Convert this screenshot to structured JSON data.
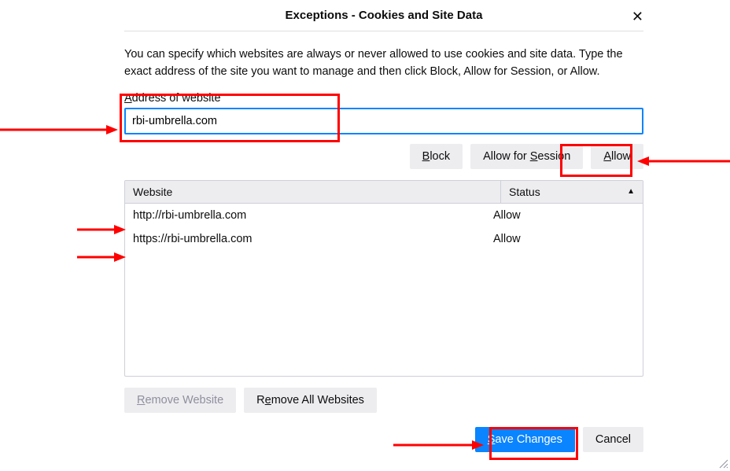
{
  "title": "Exceptions - Cookies and Site Data",
  "description": "You can specify which websites are always or never allowed to use cookies and site data. Type the exact address of the site you want to manage and then click Block, Allow for Session, or Allow.",
  "addressLabelPre": "A",
  "addressLabelRest": "ddress of website",
  "addressValue": "rbi-umbrella.com",
  "buttons": {
    "block_pre": "B",
    "block_rest": "lock",
    "afs_pre": "Allow for ",
    "afs_ul": "S",
    "afs_rest": "ession",
    "allow_ul": "A",
    "allow_rest": "llow",
    "removeWebsite_ul": "R",
    "removeWebsite_rest": "emove Website",
    "removeAll_pre": "R",
    "removeAll_ul": "e",
    "removeAll_rest": "move All Websites",
    "save_ul": "S",
    "save_rest": "ave Changes",
    "cancel": "Cancel"
  },
  "columns": {
    "website": "Website",
    "status": "Status"
  },
  "rows": [
    {
      "website": "http://rbi-umbrella.com",
      "status": "Allow"
    },
    {
      "website": "https://rbi-umbrella.com",
      "status": "Allow"
    }
  ]
}
